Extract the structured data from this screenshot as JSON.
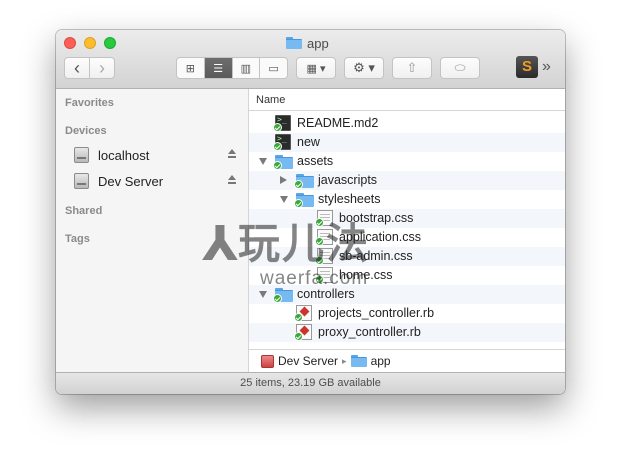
{
  "window": {
    "title": "app",
    "toolbar": {
      "back_label": "‹",
      "forward_label": "›",
      "views": [
        {
          "name": "icon-view",
          "glyph": "⊞"
        },
        {
          "name": "list-view",
          "glyph": "☰"
        },
        {
          "name": "column-view",
          "glyph": "▥"
        },
        {
          "name": "coverflow-view",
          "glyph": "▭"
        }
      ],
      "arrange_glyph": "▦ ▾",
      "action_glyph": "⚙ ▾",
      "share_glyph": "⇧",
      "tag_glyph": "⬭",
      "overflow_glyph": "»",
      "sublime_letter": "S"
    }
  },
  "sidebar": {
    "sections": [
      {
        "label": "Favorites"
      },
      {
        "label": "Devices"
      },
      {
        "label": "Shared"
      },
      {
        "label": "Tags"
      }
    ],
    "devices": [
      {
        "label": "localhost"
      },
      {
        "label": "Dev Server"
      }
    ]
  },
  "list": {
    "column_header": "Name",
    "rows": [
      {
        "name": "README.md2",
        "depth": 0,
        "kind": "term",
        "disclosure": "none"
      },
      {
        "name": "new",
        "depth": 0,
        "kind": "term",
        "disclosure": "none"
      },
      {
        "name": "assets",
        "depth": 0,
        "kind": "folder",
        "disclosure": "down"
      },
      {
        "name": "javascripts",
        "depth": 1,
        "kind": "folder",
        "disclosure": "right"
      },
      {
        "name": "stylesheets",
        "depth": 1,
        "kind": "folder",
        "disclosure": "down"
      },
      {
        "name": "bootstrap.css",
        "depth": 2,
        "kind": "doc",
        "disclosure": "none"
      },
      {
        "name": "application.css",
        "depth": 2,
        "kind": "doc",
        "disclosure": "none"
      },
      {
        "name": "sb-admin.css",
        "depth": 2,
        "kind": "doc",
        "disclosure": "none"
      },
      {
        "name": "home.css",
        "depth": 2,
        "kind": "doc",
        "disclosure": "none"
      },
      {
        "name": "controllers",
        "depth": 0,
        "kind": "folder",
        "disclosure": "down"
      },
      {
        "name": "projects_controller.rb",
        "depth": 1,
        "kind": "rb",
        "disclosure": "none"
      },
      {
        "name": "proxy_controller.rb",
        "depth": 1,
        "kind": "rb",
        "disclosure": "none"
      }
    ]
  },
  "pathbar": {
    "items": [
      {
        "label": "Dev Server"
      },
      {
        "label": "app"
      }
    ],
    "separator": "▸"
  },
  "status": {
    "text": "25 items, 23.19 GB available"
  },
  "watermark": {
    "main": "玩儿法",
    "sub": "waerfa.com"
  }
}
